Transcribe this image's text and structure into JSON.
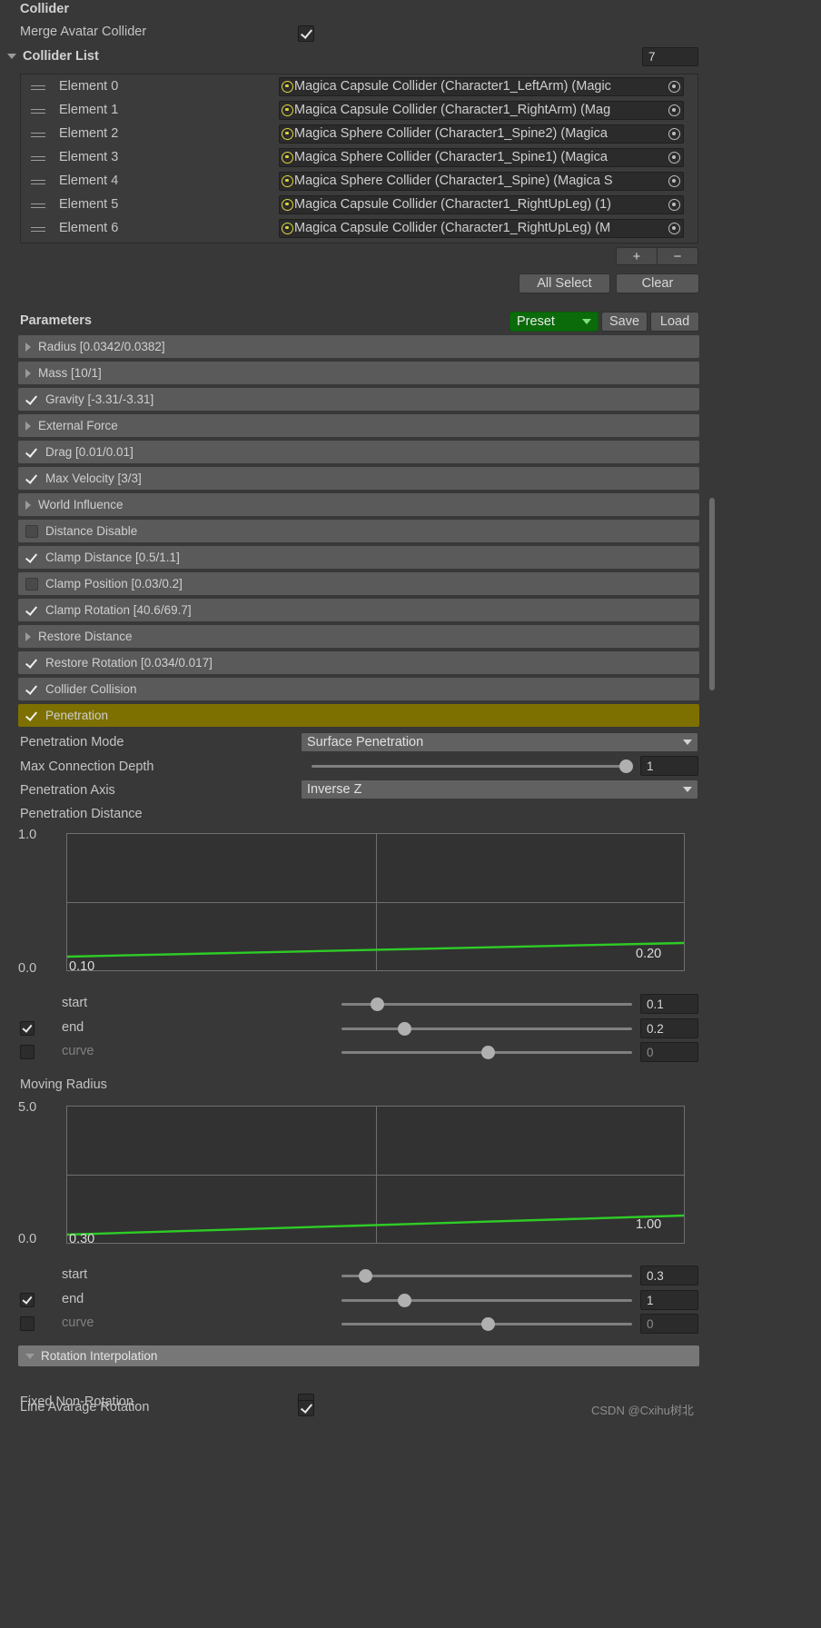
{
  "collider": {
    "title": "Collider",
    "merge_avatar_label": "Merge Avatar Collider",
    "merge_avatar_checked": true,
    "list_title": "Collider List",
    "list_size": "7",
    "elements": [
      {
        "label": "Element 0",
        "value": "Magica Capsule Collider (Character1_LeftArm) (Magic"
      },
      {
        "label": "Element 1",
        "value": "Magica Capsule Collider (Character1_RightArm) (Mag"
      },
      {
        "label": "Element 2",
        "value": "Magica Sphere Collider (Character1_Spine2) (Magica"
      },
      {
        "label": "Element 3",
        "value": "Magica Sphere Collider (Character1_Spine1) (Magica"
      },
      {
        "label": "Element 4",
        "value": "Magica Sphere Collider (Character1_Spine) (Magica S"
      },
      {
        "label": "Element 5",
        "value": "Magica Capsule Collider (Character1_RightUpLeg) (1)"
      },
      {
        "label": "Element 6",
        "value": "Magica Capsule Collider (Character1_RightUpLeg) (M"
      }
    ],
    "add_button": "+",
    "remove_button": "−",
    "all_select_button": "All Select",
    "clear_button": "Clear"
  },
  "parameters": {
    "title": "Parameters",
    "preset_label": "Preset",
    "save_label": "Save",
    "load_label": "Load",
    "rows": [
      {
        "label": "Radius [0.0342/0.0382]",
        "type": "foldout",
        "checked": false,
        "highlight": false
      },
      {
        "label": "Mass [10/1]",
        "type": "foldout",
        "checked": false,
        "highlight": false
      },
      {
        "label": "Gravity [-3.31/-3.31]",
        "type": "check",
        "checked": true,
        "highlight": false
      },
      {
        "label": "External Force",
        "type": "foldout",
        "checked": false,
        "highlight": false
      },
      {
        "label": "Drag [0.01/0.01]",
        "type": "check",
        "checked": true,
        "highlight": false
      },
      {
        "label": "Max Velocity [3/3]",
        "type": "check",
        "checked": true,
        "highlight": false
      },
      {
        "label": "World Influence",
        "type": "foldout",
        "checked": false,
        "highlight": false
      },
      {
        "label": "Distance Disable",
        "type": "check",
        "checked": false,
        "highlight": false
      },
      {
        "label": "Clamp Distance [0.5/1.1]",
        "type": "check",
        "checked": true,
        "highlight": false
      },
      {
        "label": "Clamp Position [0.03/0.2]",
        "type": "check",
        "checked": false,
        "highlight": false
      },
      {
        "label": "Clamp Rotation [40.6/69.7]",
        "type": "check",
        "checked": true,
        "highlight": false
      },
      {
        "label": "Restore Distance",
        "type": "foldout",
        "checked": false,
        "highlight": false
      },
      {
        "label": "Restore Rotation [0.034/0.017]",
        "type": "check",
        "checked": true,
        "highlight": false
      },
      {
        "label": "Collider Collision",
        "type": "check",
        "checked": true,
        "highlight": false
      },
      {
        "label": "Penetration",
        "type": "check",
        "checked": true,
        "highlight": true
      }
    ]
  },
  "penetration": {
    "mode_label": "Penetration Mode",
    "mode_value": "Surface Penetration",
    "depth_label": "Max Connection Depth",
    "depth_value": "1",
    "axis_label": "Penetration Axis",
    "axis_value": "Inverse Z",
    "distance_label": "Penetration Distance",
    "start_label": "start",
    "end_label": "end",
    "curve_label": "curve",
    "start_value": "0.1",
    "end_value": "0.2",
    "curve_value": "0",
    "end_checked": true,
    "curve_checked": false
  },
  "moving_radius": {
    "label": "Moving Radius",
    "start_label": "start",
    "end_label": "end",
    "curve_label": "curve",
    "start_value": "0.3",
    "end_value": "1",
    "curve_value": "0",
    "end_checked": true,
    "curve_checked": false
  },
  "rotation": {
    "section_label": "Rotation Interpolation",
    "fixed_label": "Fixed Non-Rotation",
    "fixed_checked": false,
    "line_label": "Line Avarage Rotation",
    "line_checked": true
  },
  "watermark": "CSDN @Cxihu树北",
  "colors": {
    "background": "#383838",
    "param_row": "#5a5a5a",
    "param_highlight": "#7d7000",
    "curve_green": "#2ecc26",
    "preset_green": "#0b6b0b",
    "object_icon_yellow": "#ded840"
  },
  "chart_data": [
    {
      "type": "line",
      "title": "Penetration Distance",
      "x": [
        0,
        1
      ],
      "values": [
        0.1,
        0.2
      ],
      "start_label": "0.10",
      "end_label": "0.20",
      "ylim": [
        0.0,
        1.0
      ],
      "ytick_labels": [
        "0.0",
        "1.0"
      ],
      "grid": true,
      "series": [
        {
          "name": "penetration distance",
          "values": [
            0.1,
            0.2
          ]
        }
      ]
    },
    {
      "type": "line",
      "title": "Moving Radius",
      "x": [
        0,
        1
      ],
      "values": [
        0.3,
        1.0
      ],
      "start_label": "0.30",
      "end_label": "1.00",
      "ylim": [
        0.0,
        5.0
      ],
      "ytick_labels": [
        "0.0",
        "5.0"
      ],
      "grid": true,
      "series": [
        {
          "name": "moving radius",
          "values": [
            0.3,
            1.0
          ]
        }
      ]
    }
  ]
}
